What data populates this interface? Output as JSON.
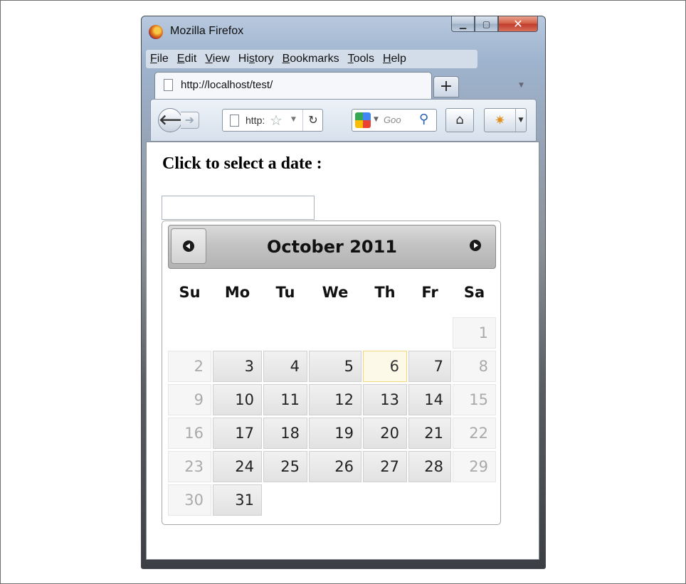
{
  "window": {
    "title": "Mozilla Firefox"
  },
  "menu": [
    "File",
    "Edit",
    "View",
    "History",
    "Bookmarks",
    "Tools",
    "Help"
  ],
  "menu_access": [
    "F",
    "E",
    "V",
    "s",
    "B",
    "T",
    "H"
  ],
  "tab": {
    "title": "http://localhost/test/"
  },
  "navbar": {
    "url": "http:",
    "search_placeholder": "Goo"
  },
  "page": {
    "heading": "Click to select a date :",
    "input_value": ""
  },
  "datepicker": {
    "month_year": "October 2011",
    "days_of_week": [
      "Su",
      "Mo",
      "Tu",
      "We",
      "Th",
      "Fr",
      "Sa"
    ],
    "first_weekday_index": 6,
    "days_in_month": 31,
    "today": 6
  }
}
